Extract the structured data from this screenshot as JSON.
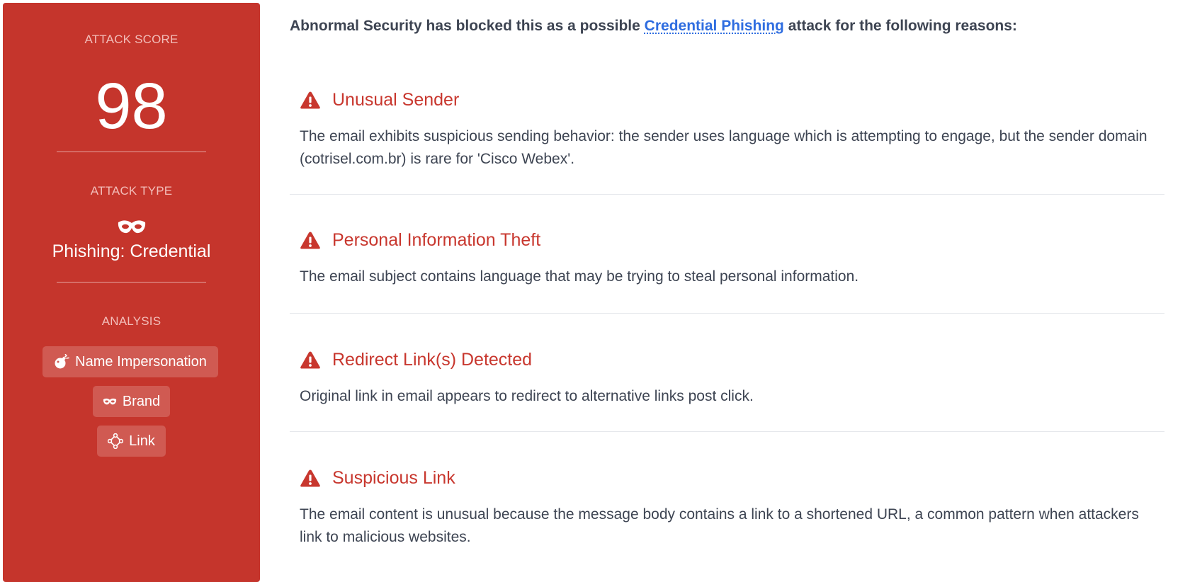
{
  "sidebar": {
    "attack_score_label": "ATTACK SCORE",
    "attack_score": "98",
    "attack_type_label": "ATTACK TYPE",
    "attack_type": "Phishing: Credential",
    "attack_type_icon": "mask-icon",
    "analysis_label": "ANALYSIS",
    "analysis_chips": [
      {
        "label": "Name Impersonation",
        "icon": "bomb-icon"
      },
      {
        "label": "Brand",
        "icon": "mask-icon"
      },
      {
        "label": "Link",
        "icon": "network-icon"
      }
    ]
  },
  "intro": {
    "prefix": "Abnormal Security has blocked this as a possible ",
    "link": "Credential Phishing",
    "suffix": " attack for the following reasons:"
  },
  "reasons": [
    {
      "title": "Unusual Sender",
      "icon": "warning-icon",
      "description": "The email exhibits suspicious sending behavior: the sender uses language which is attempting to engage, but the sender domain (cotrisel.com.br) is rare for 'Cisco Webex'."
    },
    {
      "title": "Personal Information Theft",
      "icon": "warning-icon",
      "description": "The email subject contains language that may be trying to steal personal information."
    },
    {
      "title": "Redirect Link(s) Detected",
      "icon": "warning-icon",
      "description": "Original link in email appears to redirect to alternative links post click."
    },
    {
      "title": "Suspicious Link",
      "icon": "warning-icon",
      "description": "The email content is unusual because the message body contains a link to a shortened URL, a common pattern when attackers link to malicious websites."
    }
  ],
  "colors": {
    "panel": "#c5352c",
    "chip": "#d05a52",
    "reason_title": "#c8372e",
    "link": "#2f6de0"
  }
}
